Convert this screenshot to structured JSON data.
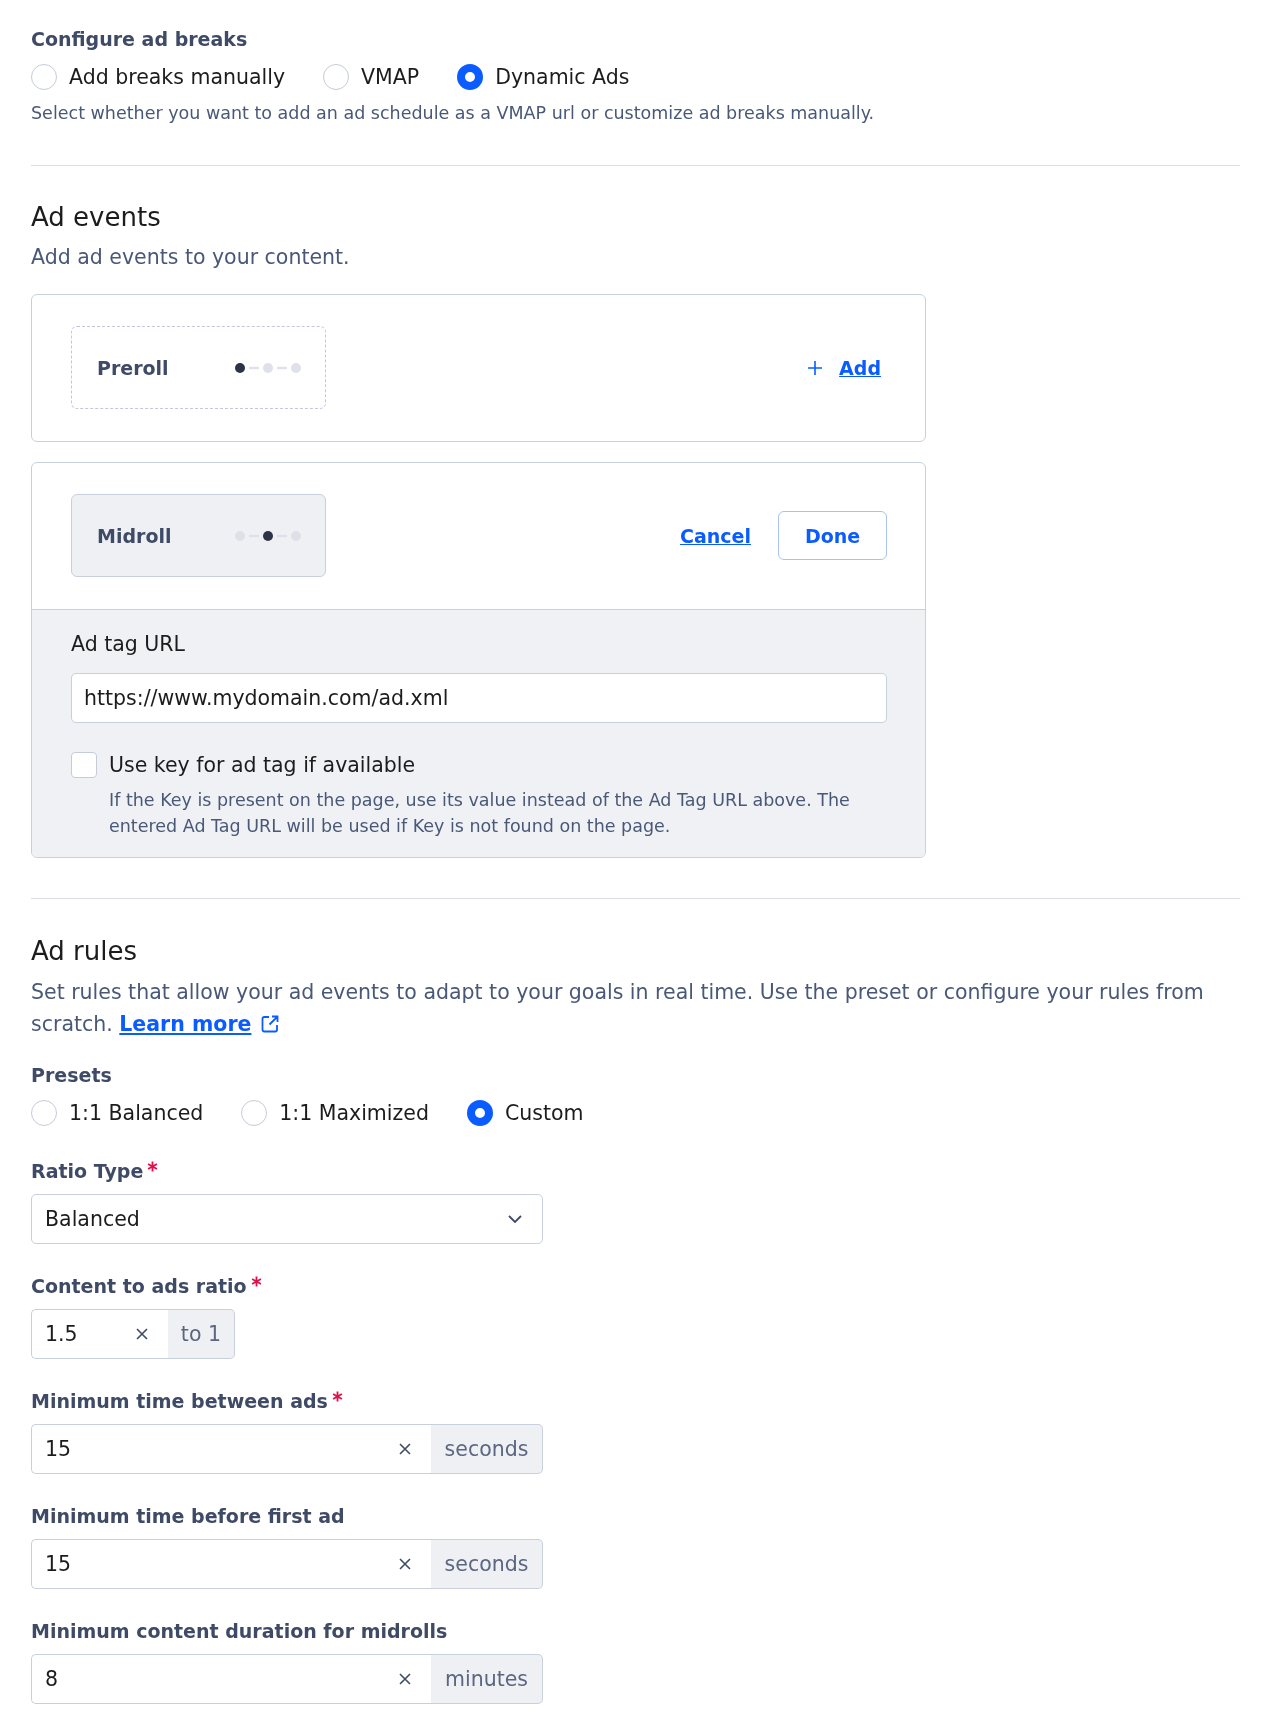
{
  "ad_breaks": {
    "label": "Configure ad breaks",
    "options": [
      {
        "label": "Add breaks manually",
        "selected": false
      },
      {
        "label": "VMAP",
        "selected": false
      },
      {
        "label": "Dynamic Ads",
        "selected": true
      }
    ],
    "help": "Select whether you want to add an ad schedule as a VMAP url or customize ad breaks manually."
  },
  "ad_events": {
    "title": "Ad events",
    "subtitle": "Add ad events to your content.",
    "events": [
      {
        "label": "Preroll",
        "editing": false,
        "dots": [
          {
            "active": true
          },
          {
            "active": false
          },
          {
            "active": false
          }
        ],
        "add_label": "Add"
      },
      {
        "label": "Midroll",
        "editing": true,
        "dots": [
          {
            "active": false
          },
          {
            "active": true
          },
          {
            "active": false
          }
        ],
        "cancel_label": "Cancel",
        "done_label": "Done",
        "ad_tag": {
          "label": "Ad tag URL",
          "value": "https://www.mydomain.com/ad.xml"
        },
        "use_key": {
          "label": "Use key for ad tag if available",
          "checked": false,
          "help": "If the Key is present on the page, use its value instead of the Ad Tag URL above. The entered Ad Tag URL will be used if Key is not found on the page."
        }
      }
    ]
  },
  "ad_rules": {
    "title": "Ad rules",
    "description": "Set rules that allow your ad events to adapt to your goals in real time. Use the preset or configure your rules from scratch.",
    "learn_more": "Learn more",
    "presets": {
      "label": "Presets",
      "options": [
        {
          "label": "1:1 Balanced",
          "selected": false
        },
        {
          "label": "1:1 Maximized",
          "selected": false
        },
        {
          "label": "Custom",
          "selected": true
        }
      ]
    },
    "fields": [
      {
        "kind": "select",
        "label": "Ratio Type",
        "required": true,
        "value": "Balanced"
      },
      {
        "kind": "narrow",
        "label": "Content to ads ratio",
        "required": true,
        "value": "1.5",
        "suffix": "to 1"
      },
      {
        "kind": "wide",
        "label": "Minimum time between ads",
        "required": true,
        "value": "15",
        "suffix": "seconds"
      },
      {
        "kind": "wide",
        "label": "Minimum time before first ad",
        "required": false,
        "value": "15",
        "suffix": "seconds"
      },
      {
        "kind": "wide",
        "label": "Minimum content duration for midrolls",
        "required": false,
        "value": "8",
        "suffix": "minutes"
      }
    ]
  }
}
